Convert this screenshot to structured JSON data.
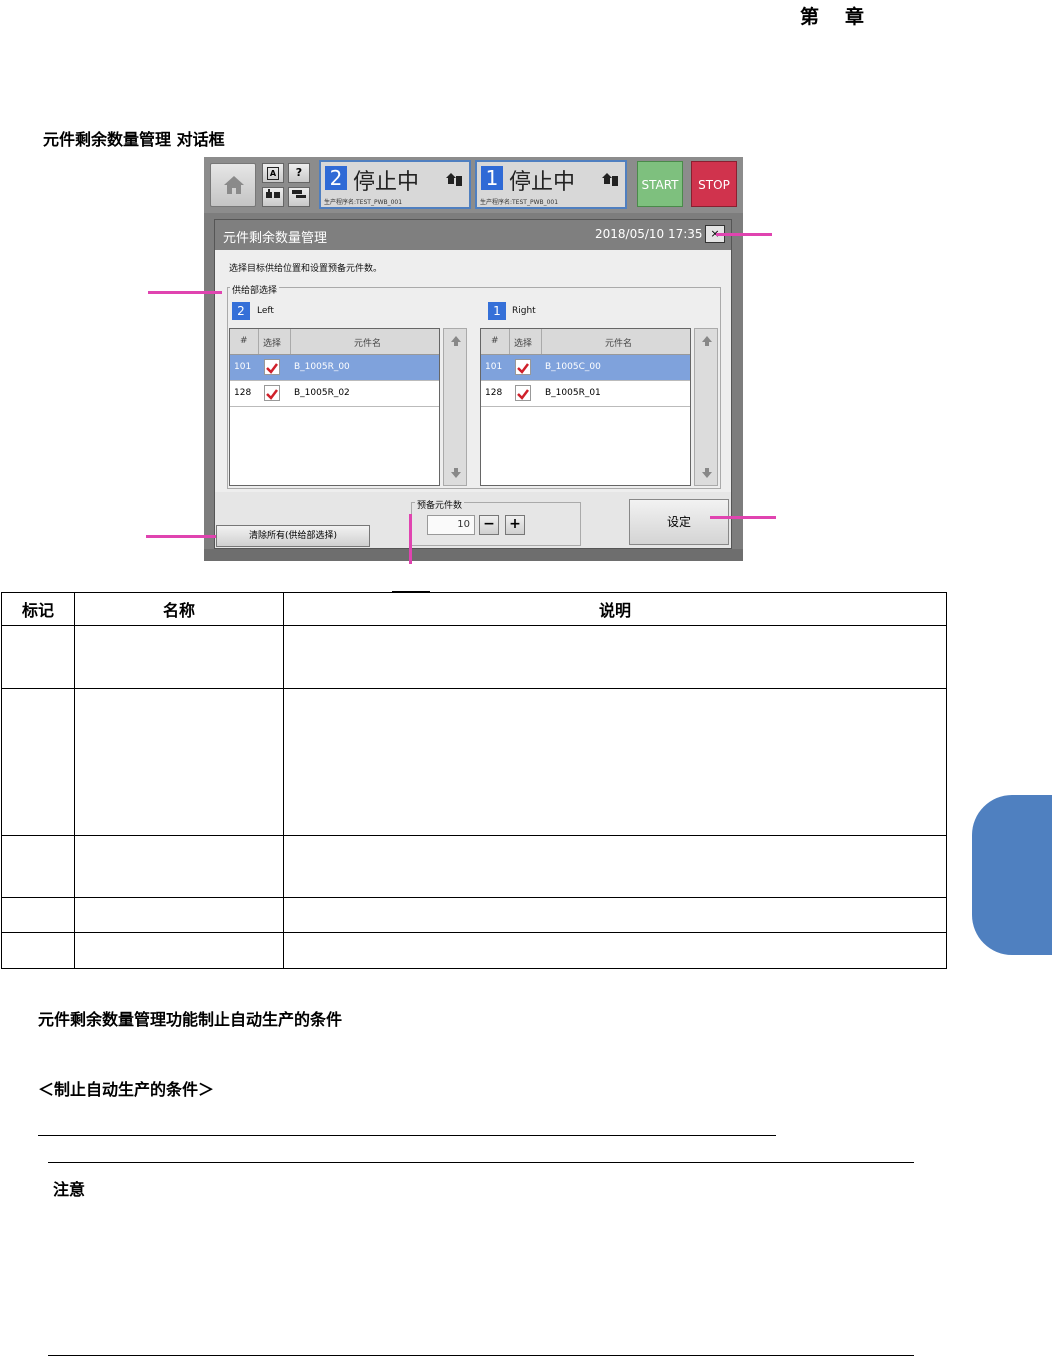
{
  "chapter": {
    "di": "第",
    "zhang": "章"
  },
  "section_title": "元件剩余数量管理  对话框",
  "screen": {
    "status_rear": {
      "num": "2",
      "state": "停止中",
      "program": "生产程序名:TEST_PWB_001"
    },
    "status_front": {
      "num": "1",
      "state": "停止中",
      "program": "生产程序名:TEST_PWB_001"
    },
    "start_label": "START",
    "stop_label": "STOP",
    "help_label": "?",
    "auto_label": "A",
    "dialog": {
      "title": "元件剩余数量管理",
      "date": "2018/05/10 17:35",
      "close_label": "×",
      "instruction": "选择目标供给位置和设置预备元件数。",
      "feeder_group_label": "供给部选择",
      "left": {
        "badge": "2",
        "label": "Left",
        "headers": [
          "#",
          "选择",
          "元件名"
        ],
        "rows": [
          {
            "no": "101",
            "name": "B_1005R_00"
          },
          {
            "no": "128",
            "name": "B_1005R_02"
          }
        ]
      },
      "right": {
        "badge": "1",
        "label": "Right",
        "headers": [
          "#",
          "选择",
          "元件名"
        ],
        "rows": [
          {
            "no": "101",
            "name": "B_1005C_00"
          },
          {
            "no": "128",
            "name": "B_1005R_01"
          }
        ]
      },
      "spare_group_label": "预备元件数",
      "spare_value": "10",
      "minus_label": "−",
      "plus_label": "+",
      "set_label": "设定",
      "clear_label": "清除所有(供给部选择)"
    }
  },
  "table": {
    "headers": [
      "标记",
      "名称",
      "说明"
    ]
  },
  "conditions_heading": "元件剩余数量管理功能制止自动生产的条件",
  "conditions_sub": "＜制止自动生产的条件＞",
  "notice_label": "注意"
}
